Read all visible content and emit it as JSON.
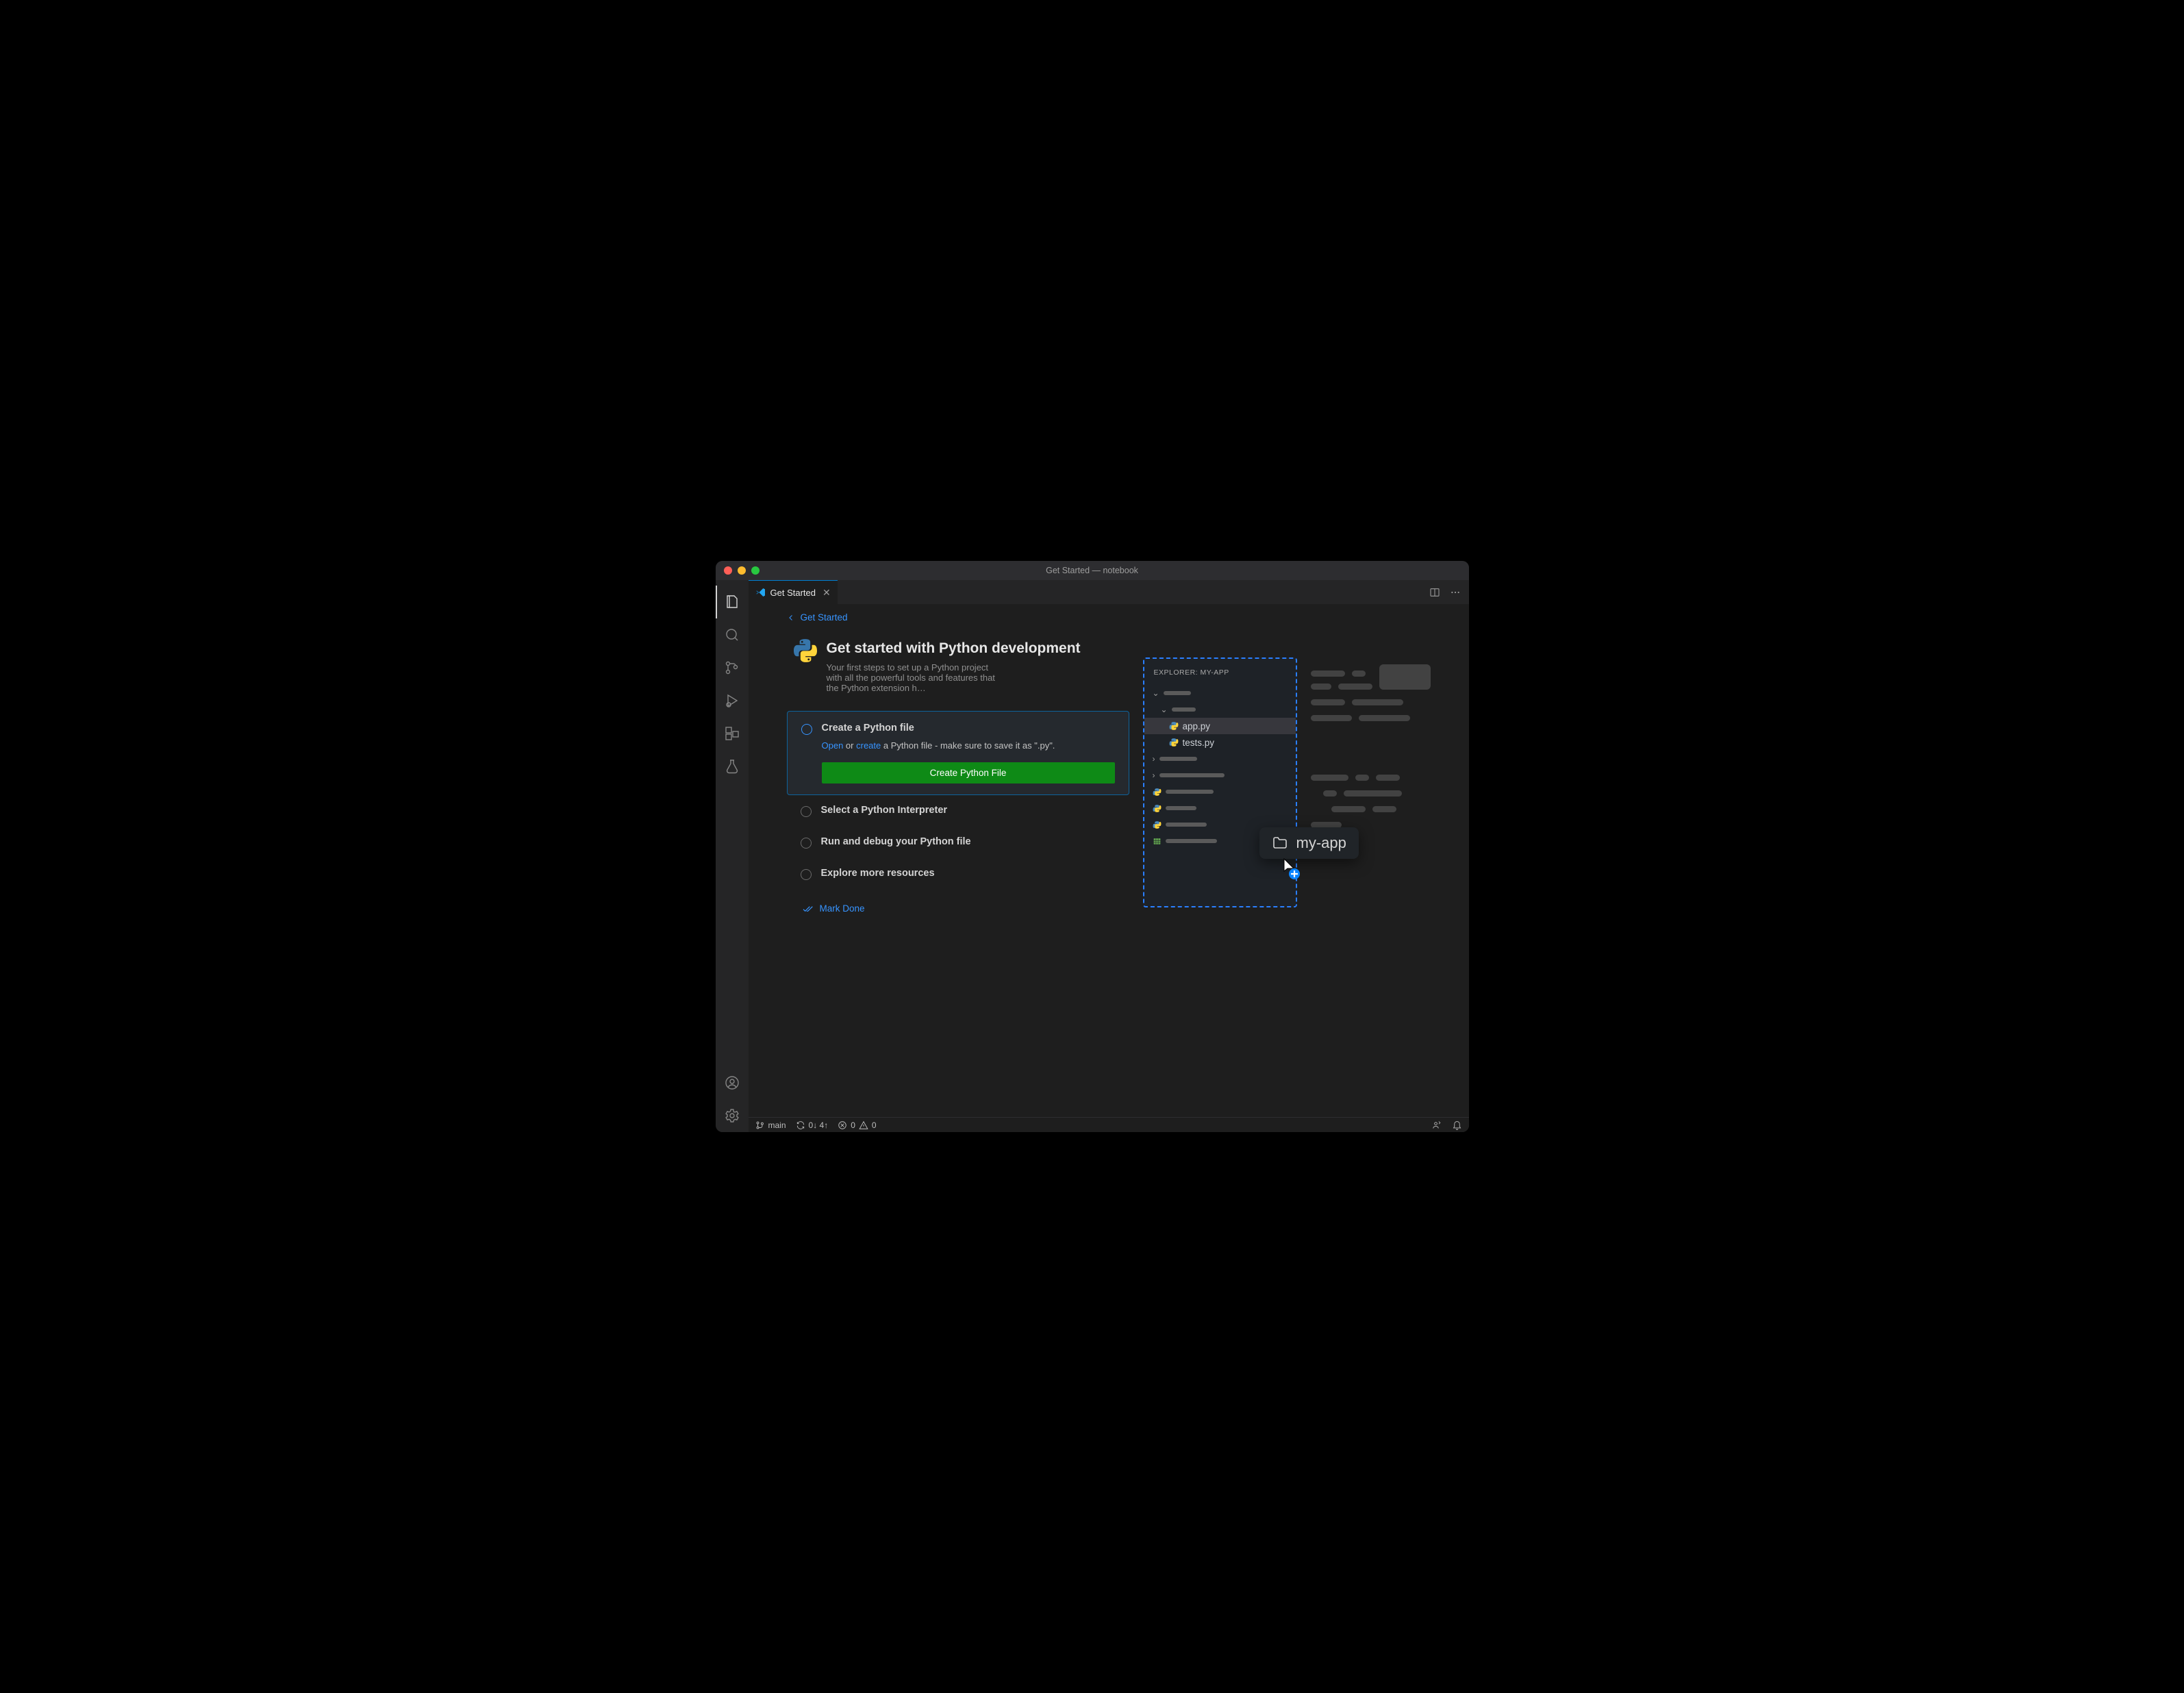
{
  "window": {
    "title": "Get Started — notebook"
  },
  "tab": {
    "label": "Get Started"
  },
  "breadcrumb": {
    "label": "Get Started"
  },
  "hero": {
    "title": "Get started with Python development",
    "subtitle": "Your first steps to set up a Python project with all the powerful tools and features that the Python extension h…"
  },
  "steps": {
    "s1": {
      "title": "Create a Python file",
      "body_pre": "",
      "link_open": "Open",
      "body_mid": " or ",
      "link_create": "create",
      "body_post": " a Python file - make sure to save it as \".py\".",
      "button": "Create Python File"
    },
    "s2": {
      "title": "Select a Python Interpreter"
    },
    "s3": {
      "title": "Run and debug your Python file"
    },
    "s4": {
      "title": "Explore more resources"
    }
  },
  "mark_done": "Mark Done",
  "illus": {
    "explorer_head": "EXPLORER: MY-APP",
    "file_app": "app.py",
    "file_tests": "tests.py",
    "drag_label": "my-app"
  },
  "status": {
    "branch": "main",
    "sync": "0↓ 4↑",
    "errors": "0",
    "warnings": "0"
  }
}
